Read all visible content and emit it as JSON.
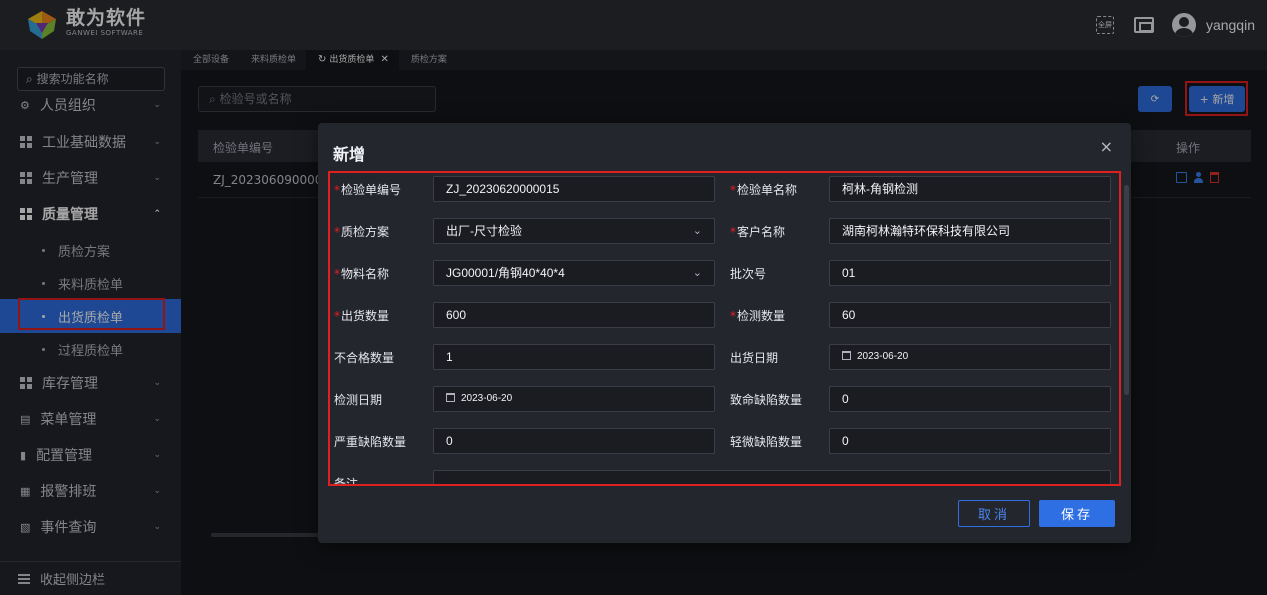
{
  "brand": {
    "name": "敢为软件",
    "sub": "GANWEI SOFTWARE"
  },
  "topbar": {
    "fullscreen_text": "全屏",
    "username": "yangqin"
  },
  "sidebar": {
    "search_placeholder": "搜索功能名称",
    "items": [
      {
        "label": "人员组织"
      },
      {
        "label": "工业基础数据"
      },
      {
        "label": "生产管理"
      },
      {
        "label": "质量管理"
      },
      {
        "label": "库存管理"
      },
      {
        "label": "菜单管理"
      },
      {
        "label": "配置管理"
      },
      {
        "label": "报警排班"
      },
      {
        "label": "事件查询"
      }
    ],
    "sub_items": [
      {
        "label": "质检方案"
      },
      {
        "label": "来料质检单"
      },
      {
        "label": "出货质检单"
      },
      {
        "label": "过程质检单"
      }
    ],
    "collapse_label": "收起侧边栏"
  },
  "tabs": [
    {
      "label": "全部设备"
    },
    {
      "label": "来料质检单"
    },
    {
      "label": "出货质检单"
    },
    {
      "label": "质检方案"
    }
  ],
  "main": {
    "search_placeholder": "检验号或名称",
    "refresh_icon": "⟳",
    "add_label": "+ 新增",
    "table": {
      "headers": [
        "检验单编号",
        "操作"
      ],
      "rows": [
        {
          "code": "ZJ_202306090000"
        }
      ]
    }
  },
  "modal": {
    "title": "新增",
    "close": "×",
    "fields": {
      "code": {
        "label": "检验单编号",
        "value": "ZJ_20230620000015"
      },
      "name": {
        "label": "检验单名称",
        "value": "柯林-角钢检测"
      },
      "plan": {
        "label": "质检方案",
        "value": "出厂-尺寸检验"
      },
      "customer": {
        "label": "客户名称",
        "value": "湖南柯林瀚特环保科技有限公司"
      },
      "material": {
        "label": "物料名称",
        "value": "JG00001/角钢40*40*4"
      },
      "batch": {
        "label": "批次号",
        "value": "01"
      },
      "ship_qty": {
        "label": "出货数量",
        "value": "600"
      },
      "check_qty": {
        "label": "检测数量",
        "value": "60"
      },
      "bad_qty": {
        "label": "不合格数量",
        "value": "1"
      },
      "ship_date": {
        "label": "出货日期",
        "value": "2023-06-20"
      },
      "check_date": {
        "label": "检测日期",
        "value": "2023-06-20"
      },
      "fatal_qty": {
        "label": "致命缺陷数量",
        "value": "0"
      },
      "serious_qty": {
        "label": "严重缺陷数量",
        "value": "0"
      },
      "minor_qty": {
        "label": "轻微缺陷数量",
        "value": "0"
      },
      "remark": {
        "label": "备注",
        "value": ""
      }
    },
    "cancel_label": "取消",
    "save_label": "保存"
  },
  "colors": {
    "accent": "#2f6fe4",
    "highlight": "#e02020",
    "required": "#e02020"
  }
}
